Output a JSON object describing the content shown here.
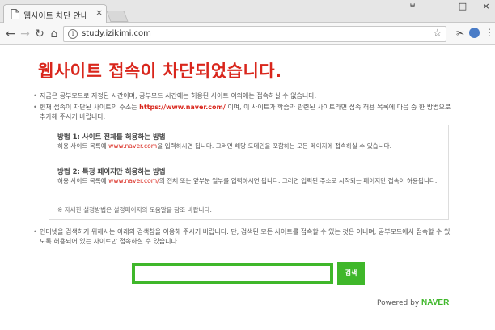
{
  "browser": {
    "tab_title": "웹사이트 차단 안내",
    "tab_close": "×",
    "window_user": "ㅂ",
    "window_minimize": "−",
    "window_maximize": "□",
    "window_close": "×",
    "url": "study.izikimi.com"
  },
  "icons": {
    "back": "←",
    "forward": "→",
    "reload": "↻",
    "home": "⌂",
    "info": "i",
    "star": "☆",
    "menu": "⋮"
  },
  "page": {
    "heading": "웹사이트 접속이 차단되었습니다.",
    "bullet1": "지금은 공부모드로 지정된 시간이며, 공부모드 시간에는 허용된 사이트 이외에는 접속하실 수 없습니다.",
    "bullet2_pre": "현재 접속이 차단된 사이트의 주소는 ",
    "bullet2_url": "https://www.naver.com/",
    "bullet2_post": " 이며, 이 사이트가 학습과 관련된 사이트라면 접속 허용 목록에 다음 중 한 방법으로 추가해 주시기 바랍니다.",
    "method1_title": "방법 1: 사이트 전체를 허용하는 방법",
    "method1_pre": "허용 사이트 목록에 ",
    "method1_url": "www.naver.com",
    "method1_post": "을 입력하시면 됩니다. 그러면 해당 도메인을 포함하는 모든 페이지에 접속하실 수 있습니다.",
    "method2_title": "방법 2: 특정 페이지만 허용하는 방법",
    "method2_pre": "허용 사이트 목록에 ",
    "method2_url": "www.naver.com/",
    "method2_post": "의 전체 또는 앞부분 일부를 입력하시면 됩니다. 그러면 입력된 주소로 시작되는 페이지만 접속이 허용됩니다.",
    "note": "※ 자세한 설정방법은 설정페이지의 도움말을 참조 바랍니다.",
    "bullet3": "인터넷을 검색하기 위해서는 아래의 검색창을 이용해 주시기 바랍니다. 단, 검색된 모든 사이트를 접속할 수 있는 것은 아니며, 공부모드에서 접속할 수 있도록 허용되어 있는 사이트만 접속하실 수 있습니다.",
    "search_value": "",
    "search_button": "검색",
    "powered_by": "Powered by ",
    "naver": "NAVER"
  },
  "colors": {
    "accent_red": "#d9261c",
    "naver_green": "#3fb72a"
  }
}
